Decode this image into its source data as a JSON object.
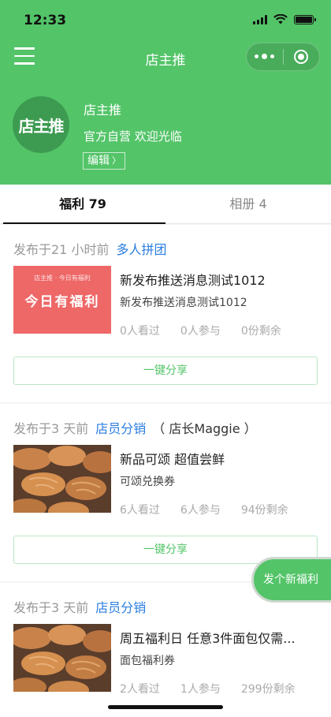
{
  "status": {
    "time": "12:33"
  },
  "nav": {
    "title": "店主推"
  },
  "shop": {
    "avatar_text": "店主推",
    "name": "店主推",
    "desc": "官方自营 欢迎光临",
    "edit_label": "编辑",
    "edit_chevron": "〉"
  },
  "tabs": [
    {
      "label": "福利 79"
    },
    {
      "label": "相册 4"
    }
  ],
  "cards": [
    {
      "posted": "发布于21 小时前",
      "tag": "多人拼团",
      "owner": "",
      "thumb_text": "今日有福利",
      "thumb_sub": "店主推 · 今日有福利",
      "title": "新发布推送消息测试1012",
      "subtitle": "新发布推送消息测试1012",
      "views": "0人看过",
      "joined": "0人参与",
      "remaining": "0份剩余",
      "share_label": "一键分享"
    },
    {
      "posted": "发布于3 天前",
      "tag": "店员分销",
      "owner": "（ 店长Maggie ）",
      "title": "新品可颂 超值尝鲜",
      "subtitle": "可颂兑换券",
      "views": "6人看过",
      "joined": "6人参与",
      "remaining": "94份剩余",
      "share_label": "一键分享"
    },
    {
      "posted": "发布于3 天前",
      "tag": "店员分销",
      "owner": "",
      "title": "周五福利日 任意3件面包仅需...",
      "subtitle": "面包福利券",
      "views": "2人看过",
      "joined": "1人参与",
      "remaining": "299份剩余"
    }
  ],
  "fab_label": "发个新福利",
  "colors": {
    "brand_green": "#53c468",
    "tag_blue": "#2a7de1"
  }
}
